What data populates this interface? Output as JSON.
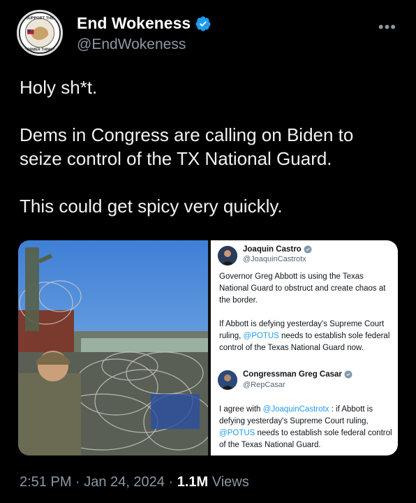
{
  "author": {
    "name": "End Wokeness",
    "handle": "@EndWokeness",
    "avatar_text_top": "SUPPORT THE",
    "avatar_text_bottom": "FORMER THINGS"
  },
  "more_label": "•••",
  "tweet": {
    "line1": "Holy sh*t.",
    "line2": "Dems in Congress are calling on Biden to seize control of the TX National Guard.",
    "line3": "This could get spicy very quickly."
  },
  "quote1": {
    "name": "Joaquin Castro",
    "handle": "@JoaquinCastrotx",
    "para1": "Governor Greg Abbott is using the Texas National Guard to obstruct and create chaos at the border.",
    "para2_a": "If Abbott is defying yesterday's Supreme Court ruling, ",
    "para2_mention": "@POTUS",
    "para2_b": " needs to establish sole federal control of the Texas National Guard now."
  },
  "quote2": {
    "name": "Congressman Greg Casar",
    "handle": "@RepCasar",
    "text_a": "I agree with ",
    "mention1": "@JoaquinCastrotx",
    "text_b": " : if Abbott is defying yesterday's Supreme Court ruling, ",
    "mention2": "@POTUS",
    "text_c": " needs to establish sole federal control of the Texas National Guard."
  },
  "footer": {
    "time": "2:51 PM",
    "sep": " · ",
    "date": "Jan 24, 2024",
    "views_count": "1.1M",
    "views_label": " Views"
  },
  "colors": {
    "background": "#000000",
    "verified": "#1d9bf0",
    "mention": "#1d9bf0"
  },
  "icons": [
    "verified-badge-icon",
    "more-options-icon"
  ]
}
